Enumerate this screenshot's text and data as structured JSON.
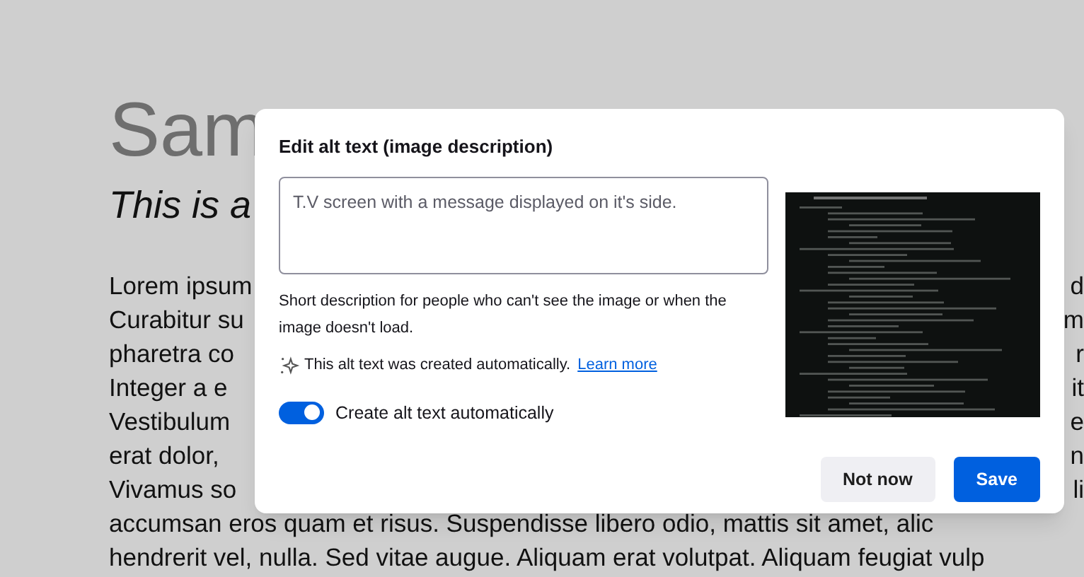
{
  "document": {
    "title": "Sam",
    "subtitle": "This is a",
    "lines": [
      {
        "left": "Lorem ipsum",
        "right": "d"
      },
      {
        "left": "Curabitur su",
        "right": "m"
      },
      {
        "left": "pharetra co",
        "right": "r"
      },
      {
        "left": "Integer a e",
        "right": "it"
      },
      {
        "left": "Vestibulum",
        "right": "e"
      },
      {
        "left": "erat dolor,",
        "right": "n"
      },
      {
        "left": "Vivamus so",
        "right": "li"
      },
      {
        "left": "accumsan eros quam et risus. Suspendisse libero odio, mattis sit amet, alic"
      },
      {
        "left": "hendrerit vel, nulla. Sed vitae augue. Aliquam erat volutpat. Aliquam feugiat vulp"
      }
    ]
  },
  "dialog": {
    "title": "Edit alt text (image description)",
    "description": {
      "value": "T.V screen with a message displayed on it's side."
    },
    "help": "Short description for people who can't see the image or when the image doesn't load.",
    "auto_note": "This alt text was created automatically.",
    "learn_more": "Learn more",
    "toggle": {
      "label": "Create alt text automatically",
      "on": true
    },
    "buttons": [
      {
        "label": "Not now",
        "kind": "secondary"
      },
      {
        "label": "Save",
        "kind": "primary"
      }
    ]
  }
}
